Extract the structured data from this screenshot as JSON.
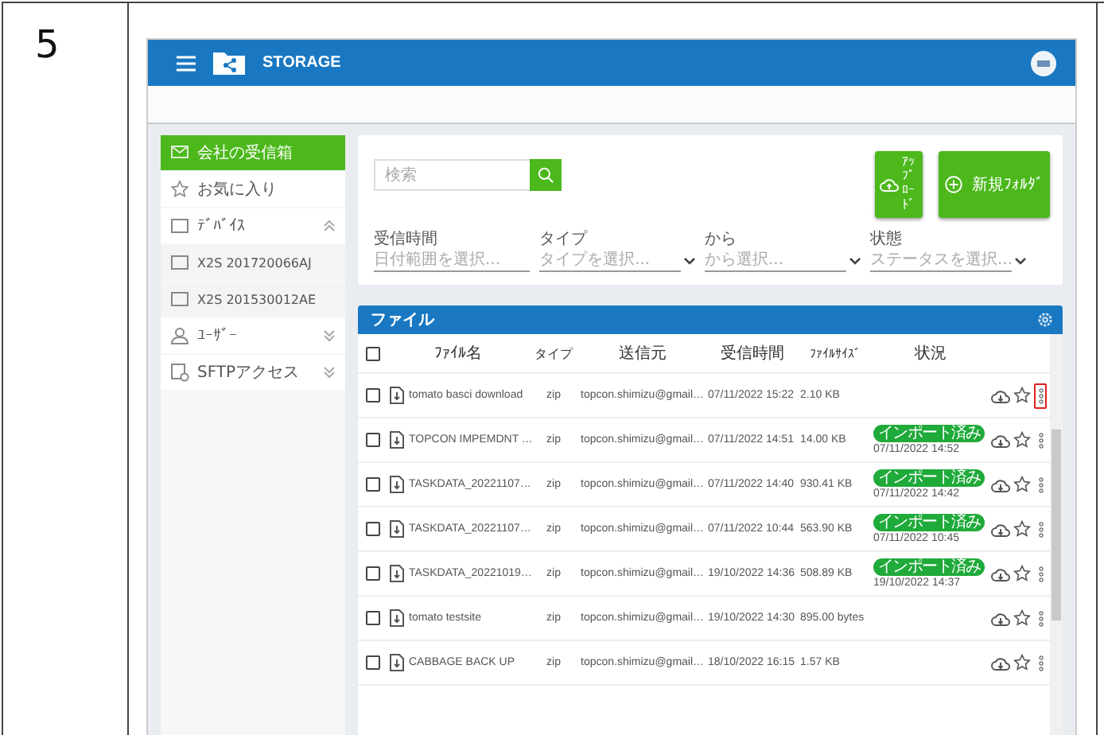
{
  "document": {
    "step": "5"
  },
  "app": {
    "title": "STORAGE"
  },
  "sidebar": {
    "items": [
      {
        "kind": "inbox",
        "label": "会社の受信箱",
        "selected": true
      },
      {
        "kind": "star",
        "label": "お気に入り",
        "selected": false
      },
      {
        "kind": "device",
        "label": "ﾃﾞﾊﾞｲｽ",
        "selected": false,
        "expanded": true,
        "children": [
          {
            "kind": "device",
            "label": "X2S 201720066AJ",
            "selected": false
          },
          {
            "kind": "device",
            "label": "X2S 201530012AE",
            "selected": false
          }
        ]
      },
      {
        "kind": "user",
        "label": "ﾕｰｻﾞｰ",
        "selected": false,
        "expanded": false
      },
      {
        "kind": "sftp",
        "label": "SFTPアクセス",
        "selected": false,
        "expanded": false
      }
    ]
  },
  "search": {
    "placeholder": "検索"
  },
  "buttons": {
    "upload": "ｱｯﾌﾟﾛｰﾄﾞ",
    "new_folder": "新規ﾌｫﾙﾀﾞ"
  },
  "filters": [
    {
      "label": "受信時間",
      "placeholder": "日付範囲を選択...",
      "dropdown": false
    },
    {
      "label": "タイプ",
      "placeholder": "タイプを選択...",
      "dropdown": true
    },
    {
      "label": "から",
      "placeholder": "から選択...",
      "dropdown": true
    },
    {
      "label": "状態",
      "placeholder": "ステータスを選択...",
      "dropdown": true
    }
  ],
  "files": {
    "title": "ファイル",
    "select_all": {
      "checked": false
    },
    "columns": [
      "ﾌｧｲﾙ名",
      "タイプ",
      "送信元",
      "受信時間",
      "ﾌｧｲﾙｻｲｽﾞ",
      "状況"
    ],
    "rows": [
      {
        "checked": false,
        "name": "tomato basci download",
        "type": "zip",
        "sender": "topcon.shimizu@gmail…",
        "received": "07/11/2022 15:22",
        "size": "2.10 KB",
        "highlighted": true
      },
      {
        "checked": false,
        "name": "TOPCON IMPEMDNT …",
        "type": "zip",
        "sender": "topcon.shimizu@gmail…",
        "received": "07/11/2022 14:51",
        "size": "14.00 KB",
        "status": {
          "badge": "インポート済み",
          "time": "07/11/2022 14:52"
        },
        "highlighted": false
      },
      {
        "checked": false,
        "name": "TASKDATA_20221107…",
        "type": "zip",
        "sender": "topcon.shimizu@gmail…",
        "received": "07/11/2022 14:40",
        "size": "930.41 KB",
        "status": {
          "badge": "インポート済み",
          "time": "07/11/2022 14:42"
        },
        "highlighted": false
      },
      {
        "checked": false,
        "name": "TASKDATA_20221107…",
        "type": "zip",
        "sender": "topcon.shimizu@gmail…",
        "received": "07/11/2022 10:44",
        "size": "563.90 KB",
        "status": {
          "badge": "インポート済み",
          "time": "07/11/2022 10:45"
        },
        "highlighted": false
      },
      {
        "checked": false,
        "name": "TASKDATA_20221019…",
        "type": "zip",
        "sender": "topcon.shimizu@gmail…",
        "received": "19/10/2022 14:36",
        "size": "508.89 KB",
        "status": {
          "badge": "インポート済み",
          "time": "19/10/2022 14:37"
        },
        "highlighted": false
      },
      {
        "checked": false,
        "name": "tomato testsite",
        "type": "zip",
        "sender": "topcon.shimizu@gmail…",
        "received": "19/10/2022 14:30",
        "size": "895.00 bytes",
        "highlighted": false
      },
      {
        "checked": false,
        "name": "CABBAGE BACK UP",
        "type": "zip",
        "sender": "topcon.shimizu@gmail…",
        "received": "18/10/2022 16:15",
        "size": "1.57 KB",
        "highlighted": false
      }
    ]
  }
}
